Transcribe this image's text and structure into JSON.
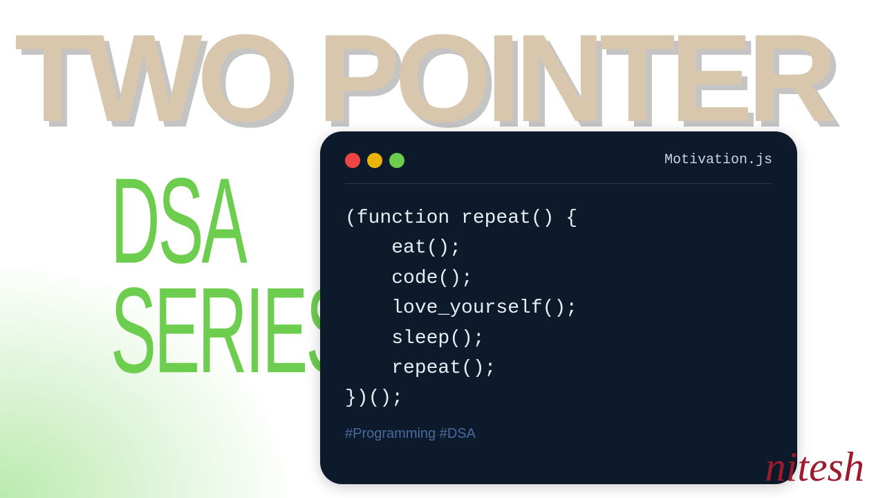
{
  "title": "TWO POINTER",
  "subtitle_line1": "DSA",
  "subtitle_line2": "SERIES",
  "window": {
    "filename": "Motivation.js",
    "code": "(function repeat() {\n    eat();\n    code();\n    love_yourself();\n    sleep();\n    repeat();\n})();",
    "hashtags": "#Programming #DSA"
  },
  "signature": "nitesh",
  "colors": {
    "title_fg": "#d9c7ad",
    "title_shadow": "#c4c4c4",
    "subtitle": "#6dcd4e",
    "window_bg": "#0c1a2c",
    "code_fg": "#e6edf3",
    "hashtag": "#4a6a9e",
    "signature": "#9c1c2e"
  }
}
